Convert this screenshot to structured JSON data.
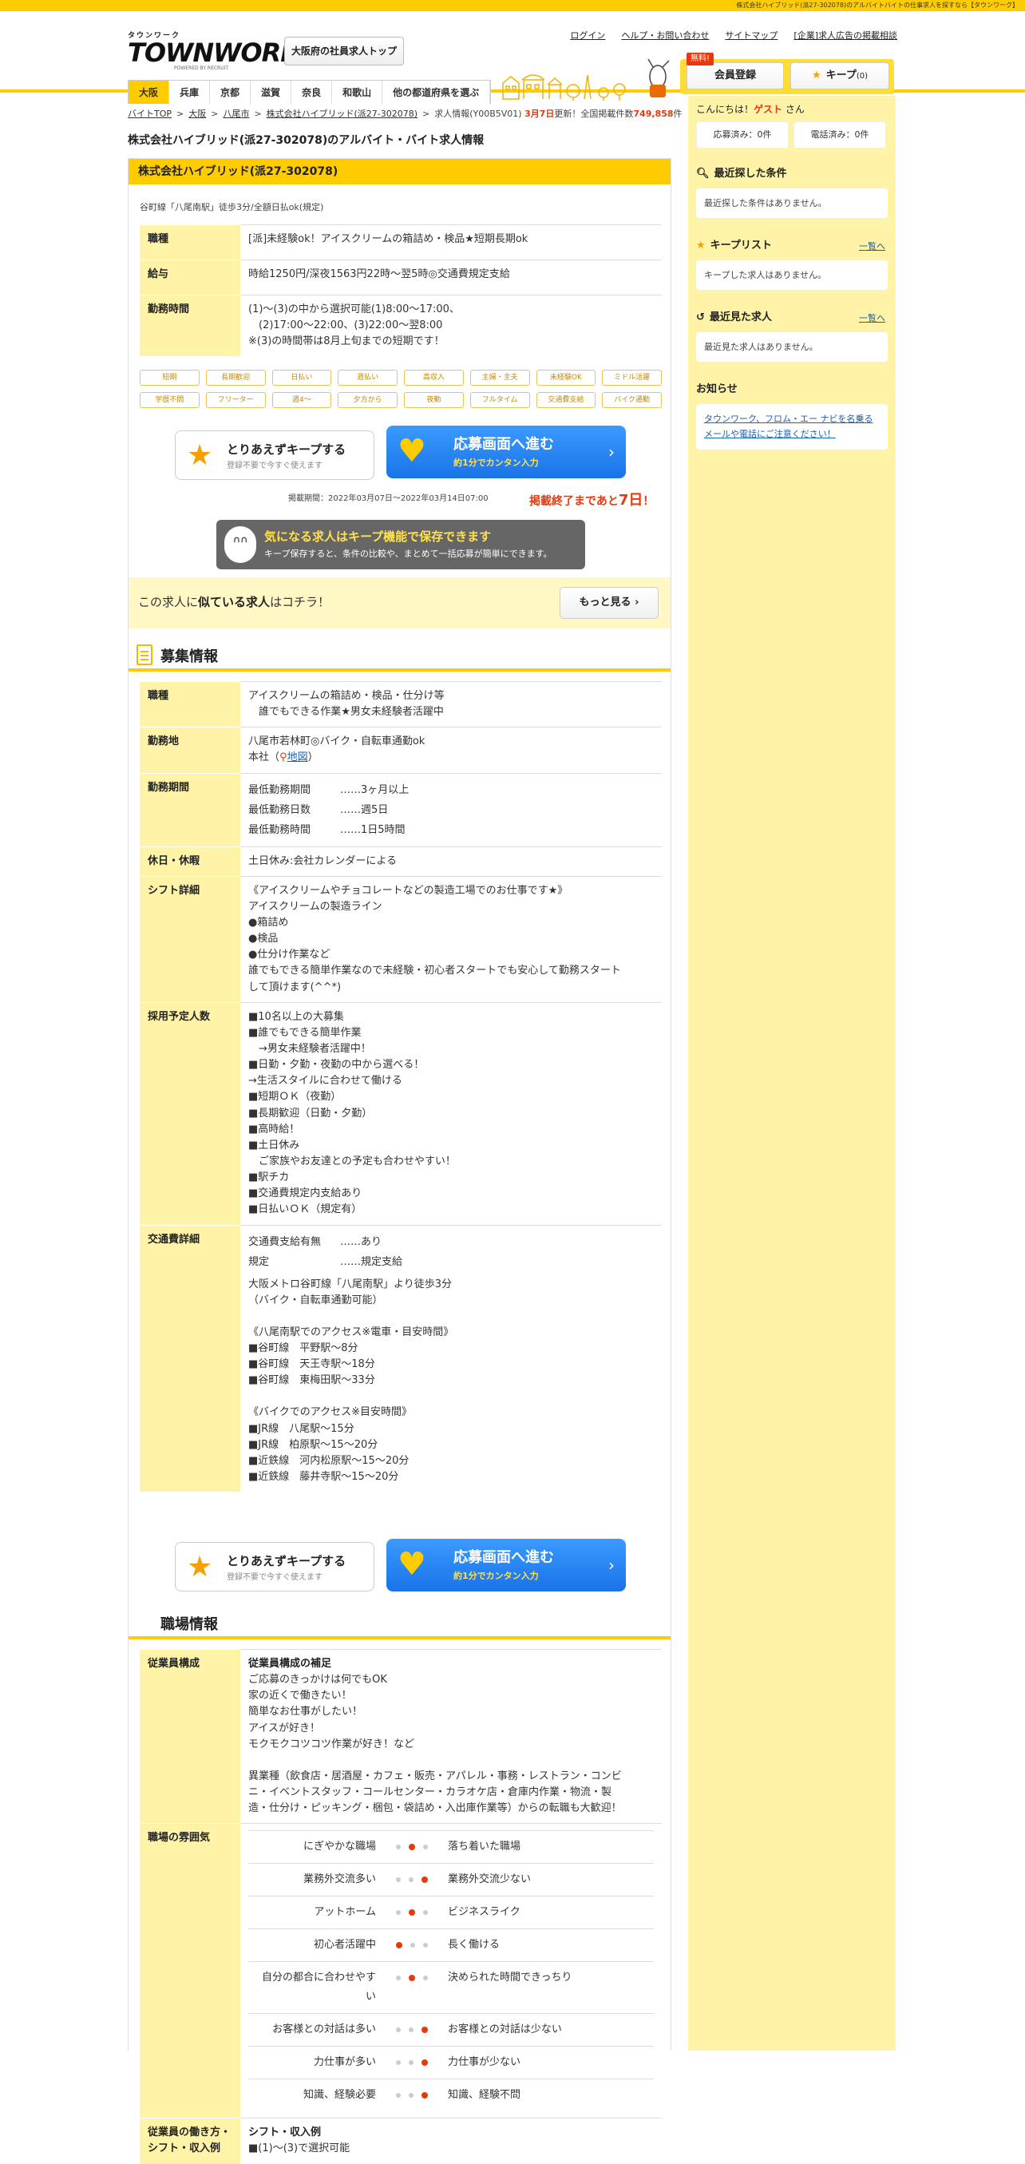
{
  "topbar": {
    "text": "株式会社ハイブリッド(派27-302078)のアルバイトバイトの仕事求人を探すなら【タウンワーク】"
  },
  "header": {
    "logo_kana": "タウンワーク",
    "logo_main": "TOWNWORK",
    "logo_sub": "POWERED BY RECRUIT",
    "region_top": "大阪府の社員求人トップ",
    "links": [
      "ログイン",
      "ヘルプ・お問い合わせ",
      "サイトマップ",
      "[企業]求人広告の掲載相談"
    ],
    "pref_tabs": [
      "大阪",
      "兵庫",
      "京都",
      "滋賀",
      "奈良",
      "和歌山",
      "他の都道府県を選ぶ"
    ],
    "free_badge": "無料!",
    "member_label": "会員登録",
    "keep_label": "キープ",
    "keep_count": "(0)"
  },
  "breadcrumb": {
    "items": [
      "バイトTOP",
      "大阪",
      "八尾市",
      "株式会社ハイブリッド(派27-302078)"
    ],
    "current": "求人情報(Y00B5V01)",
    "updated_date": "3月7日",
    "updated_text": "更新！全国掲載件数",
    "total_count": "749,858",
    "count_unit": "件"
  },
  "page_title": "株式会社ハイブリッド(派27-302078)のアルバイト・バイト求人情報",
  "job": {
    "company": "株式会社ハイブリッド(派27-302078)",
    "catch": "谷町線「八尾南駅」徒歩3分/全額日払ok(規定)",
    "summary": [
      {
        "label": "職種",
        "lines": [
          "[派]未経験ok！アイスクリームの箱詰め・検品★短期長期ok"
        ]
      },
      {
        "label": "給与",
        "lines": [
          "時給1250円/深夜1563円22時～翌5時◎交通費規定支給"
        ]
      },
      {
        "label": "勤務時間",
        "lines": [
          "(1)～(3)の中から選択可能(1)8:00～17:00、",
          "　(2)17:00～22:00、(3)22:00～翌8:00",
          "※(3)の時間帯は8月上旬までの短期です！"
        ]
      }
    ],
    "tags": [
      "短期",
      "長期歓迎",
      "日払い",
      "週払い",
      "高収入",
      "主婦・主夫",
      "未経験OK",
      "ミドル活躍",
      "学歴不問",
      "フリーター",
      "週4～",
      "夕方から",
      "夜勤",
      "フルタイム",
      "交通費支給",
      "バイク通勤"
    ],
    "keep_cta_title": "とりあえずキープする",
    "keep_cta_sub": "登録不要で今すぐ使えます",
    "apply_cta_title": "応募画面へ進む",
    "apply_cta_sub": "約1分でカンタン入力",
    "period": "掲載期間：2022年03月07日～2022年03月14日07:00",
    "remaining_prefix": "掲載終了まであと",
    "remaining_days": "7日",
    "remaining_suffix": "！",
    "keep_promo_title": "気になる求人はキープ機能で保存できます",
    "keep_promo_sub": "キープ保存すると、条件の比較や、まとめて一括応募が簡単にできます。",
    "similar_prefix": "この求人に",
    "similar_bold": "似ている求人",
    "similar_suffix": "はコチラ！",
    "similar_more": "もっと見る"
  },
  "recruit": {
    "heading": "募集情報",
    "job_type_label": "職種",
    "job_type_lines": [
      "アイスクリームの箱詰め・検品・仕分け等",
      "　誰でもできる作業★男女未経験者活躍中"
    ],
    "location_label": "勤務地",
    "location_lines": [
      "八尾市若林町◎バイク・自転車通勤ok"
    ],
    "location_office": "本社",
    "map_label": "地図",
    "period_label": "勤務期間",
    "period_rows": [
      {
        "k": "最低勤務期間",
        "v": "……3ヶ月以上"
      },
      {
        "k": "最低勤務日数",
        "v": "……週5日"
      },
      {
        "k": "最低勤務時間",
        "v": "……1日5時間"
      }
    ],
    "holiday_label": "休日・休暇",
    "holiday_lines": [
      "土日休み:会社カレンダーによる"
    ],
    "shift_label": "シフト詳細",
    "shift_lines": [
      "《アイスクリームやチョコレートなどの製造工場でのお仕事です★》",
      "アイスクリームの製造ライン",
      "●箱詰め",
      "●検品",
      "●仕分け作業など",
      "誰でもできる簡単作業なので未経験・初心者スタートでも安心して勤務スタート",
      "して頂けます(^^*)"
    ],
    "hire_label": "採用予定人数",
    "hire_lines": [
      "■10名以上の大募集",
      "■誰でもできる簡単作業",
      "　→男女未経験者活躍中！",
      "■日勤・夕勤・夜勤の中から選べる！",
      "→生活スタイルに合わせて働ける",
      "■短期ＯＫ（夜勤）",
      "■長期歓迎（日勤・夕勤）",
      "■高時給！",
      "■土日休み",
      "　ご家族やお友達との予定も合わせやすい！",
      "■駅チカ",
      "■交通費規定内支給あり",
      "■日払いＯＫ（規定有）"
    ],
    "transport_label": "交通費詳細",
    "transport_rows": [
      {
        "k": "交通費支給有無",
        "v": "……あり"
      },
      {
        "k": "規定",
        "v": "……規定支給"
      }
    ],
    "transport_lines": [
      "大阪メトロ谷町線「八尾南駅」より徒歩3分",
      "（バイク・自転車通勤可能）",
      "",
      "《八尾南駅でのアクセス※電車・目安時間》",
      "■谷町線　平野駅～8分",
      "■谷町線　天王寺駅～18分",
      "■谷町線　東梅田駅～33分",
      "",
      "《バイクでのアクセス※目安時間》",
      "■JR線　八尾駅～15分",
      "■JR線　柏原駅～15～20分",
      "■近鉄線　河内松原駅～15～20分",
      "■近鉄線　藤井寺駅～15～20分"
    ]
  },
  "workplace": {
    "heading": "職場情報",
    "staff_label": "従業員構成",
    "staff_title": "従業員構成の補足",
    "staff_lines": [
      "ご応募のきっかけは何でもOK",
      "家の近くで働きたい！",
      "簡単なお仕事がしたい！",
      "アイスが好き！",
      "モクモクコツコツ作業が好き！など",
      "",
      "異業種（飲食店・居酒屋・カフェ・販売・アパレル・事務・レストラン・コンビ",
      "ニ・イベントスタッフ・コールセンター・カラオケ店・倉庫内作業・物流・製",
      "造・仕分け・ピッキング・梱包・袋詰め・入出庫作業等）からの転職も大歓迎！"
    ],
    "mood_label": "職場の雰囲気",
    "mood_rows": [
      {
        "left": "にぎやかな職場",
        "right": "落ち着いた職場",
        "pos": 2
      },
      {
        "left": "業務外交流多い",
        "right": "業務外交流少ない",
        "pos": 3
      },
      {
        "left": "アットホーム",
        "right": "ビジネスライク",
        "pos": 2
      },
      {
        "left": "初心者活躍中",
        "right": "長く働ける",
        "pos": 1
      },
      {
        "left": "自分の都合に合わせやすい",
        "right": "決められた時間できっちり",
        "pos": 2
      },
      {
        "left": "お客様との対話は多い",
        "right": "お客様との対話は少ない",
        "pos": 3
      },
      {
        "left": "力仕事が多い",
        "right": "力仕事が少ない",
        "pos": 3
      },
      {
        "left": "知識、経験必要",
        "right": "知識、経験不問",
        "pos": 3
      }
    ],
    "style_label": "従業員の働き方・シフト・収入例",
    "style_title": "シフト・収入例",
    "style_lines": [
      "■(1)～(3)で選択可能"
    ]
  },
  "sidebar": {
    "greet_prefix": "こんにちは！",
    "guest": "ゲスト",
    "greet_suffix": "さん",
    "applied": "応募済み：0件",
    "called": "電話済み：0件",
    "recent_search_title": "最近探した条件",
    "recent_search_empty": "最近探した条件はありません。",
    "keep_list_title": "キープリスト",
    "keep_list_more": "一覧へ",
    "keep_list_empty": "キープした求人はありません。",
    "recent_viewed_title": "最近見た求人",
    "recent_viewed_more": "一覧へ",
    "recent_viewed_empty": "最近見た求人はありません。",
    "notice_title": "お知らせ",
    "notice_link": "タウンワーク、フロム・エー ナビを名乗るメールや電話にご注意ください！"
  },
  "colors": {
    "brand_yellow": "#ffcc00",
    "pale_yellow": "#fff3a8",
    "accent_red": "#e8380d",
    "apply_blue": "#1a73e8"
  }
}
